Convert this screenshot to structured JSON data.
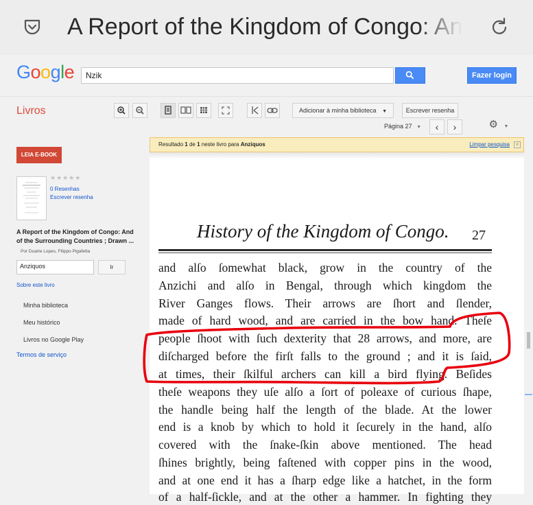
{
  "browser": {
    "tab_title": "A Report of the Kingdom of Congo: An",
    "pocket_icon": "pocket-icon",
    "reload_icon": "reload-icon"
  },
  "header": {
    "logo": "Google",
    "search_value": "Nzik",
    "search_icon": "search-icon",
    "login_label": "Fazer login",
    "logo_colors": [
      "#4285f4",
      "#ea4335",
      "#fbbc05",
      "#4285f4",
      "#34a853",
      "#ea4335"
    ]
  },
  "toolbar": {
    "section": "Livros",
    "add_library": "Adicionar à minha biblioteca",
    "write_review": "Escrever resenha",
    "page_select": "Página 27",
    "icons": [
      "zoom-in-icon",
      "zoom-out-icon",
      "single-page-icon",
      "two-page-icon",
      "thumbnail-grid-icon",
      "fullscreen-icon",
      "clip-icon",
      "link-icon",
      "gear-icon"
    ]
  },
  "notice": {
    "prefix": "Resultado",
    "num": "1",
    "mid": "de",
    "total": "1",
    "suffix": "neste livro para",
    "query": "Anziquos",
    "clear": "Limpar pesquisa"
  },
  "sidebar": {
    "ebook_button": "LEIA E-BOOK",
    "stars": "★★★★★",
    "reviews": "0 Resenhas",
    "write_review": "Escrever resenha",
    "book_title": "A Report of the Kingdom of Congo: And of the Surrounding Countries ; Drawn ...",
    "author": "Por Duarte Lopes, Filippo Pigafetta",
    "search_value": "Anziquos",
    "search_button": "Ir",
    "about": "Sobre este livro",
    "nav": [
      "Minha biblioteca",
      "Meu histórico",
      "Livros no Google Play"
    ],
    "terms": "Termos de serviço"
  },
  "page": {
    "header": "History of the Kingdom of Congo.",
    "number": "27",
    "lines": [
      "and alſo ſomewhat black, grow in the country of the",
      "Anzichi and alſo in Bengal, through which kingdom the",
      "River Ganges flows. Their arrows are ſhort and ſlender,",
      "made of hard wood, and are carried in the bow hand. Theſe",
      "people ſhoot with ſuch dexterity that 28 arrows, and more, are",
      "diſcharged before the firſt falls to the ground ; and it is ſaid,",
      "at times, their ſkilful archers can kill a bird flying. Beſides",
      "theſe weapons they uſe alſo a ſort of poleaxe of curious ſhape,",
      "the handle being half the length of the blade. At the lower",
      "end is a knob by which to hold it ſecurely in the hand, alſo",
      "covered with the ſnake-ſkin above mentioned. The head",
      "ſhines brightly, being faſtened with copper pins in the wood,",
      "and at one end it has a ſharp edge like a hatchet, in the form",
      "of a half-ſickle, and at the other a hammer. In fighting they"
    ],
    "annotation_color": "#e8000e"
  }
}
